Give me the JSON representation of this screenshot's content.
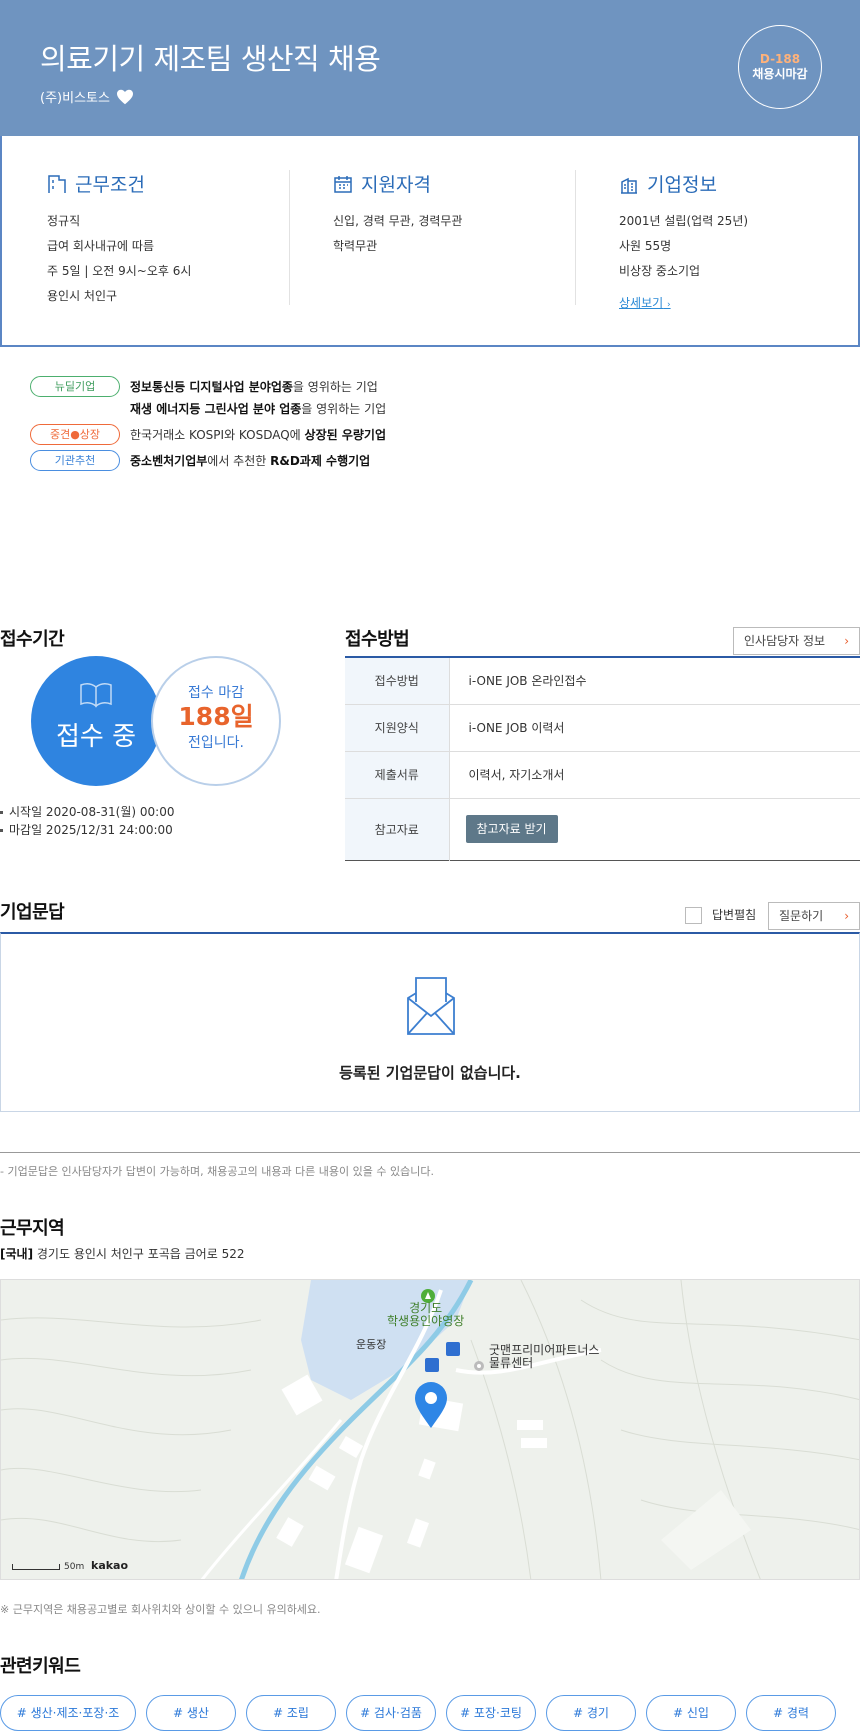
{
  "header": {
    "title": "의료기기 제조팀 생산직 채용",
    "company": "(주)비스토스",
    "dday": "D-188",
    "deadline_type": "채용시마감",
    "bg_color": "#6f94c0"
  },
  "summary": {
    "work": {
      "title": "근무조건",
      "icon": "building-icon",
      "lines": [
        "정규직",
        "급여 회사내규에 따름",
        "주 5일 | 오전 9시~오후 6시",
        "용인시 처인구"
      ]
    },
    "qualify": {
      "title": "지원자격",
      "icon": "calendar-icon",
      "lines": [
        "신입, 경력 무관, 경력무관",
        "학력무관"
      ]
    },
    "company": {
      "title": "기업정보",
      "icon": "office-icon",
      "lines": [
        "2001년 설립(업력 25년)",
        "사원 55명",
        "비상장 중소기업"
      ],
      "more": "상세보기"
    }
  },
  "badges": [
    {
      "label": "뉴딜기업",
      "lines": [
        [
          "정보통신등 디지털사업 분야업종",
          "을 영위하는 기업"
        ],
        [
          "재생 에너지등 그린사업 분야 업종",
          "을 영위하는 기업"
        ]
      ]
    },
    {
      "label": "중견●상장",
      "pre": "한국거래소 KOSPI와 KOSDAQ에 ",
      "bold": "상장된 우량기업"
    },
    {
      "label": "기관추천",
      "bold1": "중소벤처기업부",
      "mid": "에서 추천한 ",
      "bold2": "R&D과제 수행기업"
    }
  ],
  "reception": {
    "title": "접수기간",
    "status": "접수 중",
    "until_label": "접수 마감",
    "days": "188일",
    "days_suffix": "전입니다.",
    "start": "시작일 2020-08-31(월) 00:00",
    "end": "마감일 2025/12/31 24:00:00"
  },
  "method": {
    "title": "접수방법",
    "hr_button": "인사담당자 정보",
    "rows": [
      {
        "th": "접수방법",
        "td": "i-ONE JOB 온라인접수"
      },
      {
        "th": "지원양식",
        "td": "i-ONE JOB 이력서"
      },
      {
        "th": "제출서류",
        "td": "이력서, 자기소개서"
      },
      {
        "th": "참고자료",
        "button": "참고자료 받기"
      }
    ]
  },
  "qna": {
    "title": "기업문답",
    "expand_label": "답변펼침",
    "ask_button": "질문하기",
    "empty": "등록된 기업문답이 없습니다.",
    "note": "- 기업문답은 인사담당자가 답변이 가능하며, 채용공고의 내용과 다른 내용이 있을 수 있습니다."
  },
  "location": {
    "title": "근무지역",
    "tag": "[국내]",
    "address": "경기도 용인시 처인구 포곡읍 금어로 522",
    "map": {
      "poi1": "경기도",
      "poi1b": "학생용인야영장",
      "poi2": "운동장",
      "poi3": "굿맨프리미어파트너스",
      "poi3b": "물류센터",
      "scale": "50m",
      "brand": "kakao"
    },
    "note": "※ 근무지역은 채용공고별로 회사위치와 상이할 수 있으니 유의하세요."
  },
  "keywords": {
    "title": "관련키워드",
    "items": [
      "# 생산·제조·포장·조립",
      "# 생산",
      "# 조립",
      "# 검사·검품",
      "# 포장·코팅",
      "# 경기",
      "# 신입",
      "# 경력"
    ]
  }
}
